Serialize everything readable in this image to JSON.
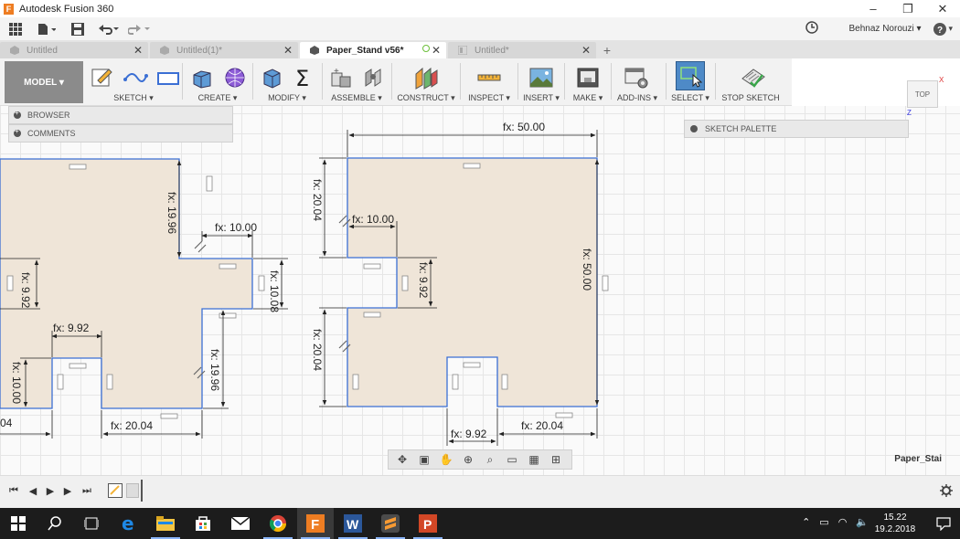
{
  "window": {
    "title": "Autodesk Fusion 360",
    "logo_letter": "F"
  },
  "quick_access": {
    "user": "Behnaz Norouzi ▾",
    "help": "?"
  },
  "tabs": [
    {
      "label": "Untitled",
      "active": false
    },
    {
      "label": "Untitled(1)*",
      "active": false
    },
    {
      "label": "Paper_Stand v56*",
      "active": true
    },
    {
      "label": "Untitled*",
      "active": false
    }
  ],
  "toolbar": {
    "workspace": "MODEL ▾",
    "groups": [
      {
        "label": "SKETCH ▾"
      },
      {
        "label": "CREATE ▾"
      },
      {
        "label": "MODIFY ▾"
      },
      {
        "label": "ASSEMBLE ▾"
      },
      {
        "label": "CONSTRUCT ▾"
      },
      {
        "label": "INSPECT ▾"
      },
      {
        "label": "INSERT ▾"
      },
      {
        "label": "MAKE ▾"
      },
      {
        "label": "ADD-INS ▾"
      },
      {
        "label": "SELECT ▾"
      },
      {
        "label": "STOP SKETCH"
      }
    ]
  },
  "panels": {
    "browser": "BROWSER",
    "comments": "COMMENTS",
    "sketch_palette": "SKETCH PALETTE"
  },
  "viewcube": {
    "label": "TOP",
    "axis_x": "X",
    "axis_z": "Z"
  },
  "dimensions": {
    "d1": "fx: 50.00",
    "d2": "fx: 20.04",
    "d3": "fx: 10.00",
    "d4": "fx: 9.92",
    "d5": "fx: 50.00",
    "d6": "fx: 20.04",
    "d7": "fx: 9.92",
    "d8": "fx: 20.04",
    "l1": "fx: 19.96",
    "l2": "fx: 10.00",
    "l3": "fx: 9.92",
    "l4": "fx: 10.08",
    "l5": "fx: 9.92",
    "l6": "fx: 10.00",
    "l7": "fx: 19.96",
    "l8": "fx: 20.04",
    "l9": "04"
  },
  "document_label": "Paper_Stai",
  "taskbar": {
    "time": "15.22",
    "date": "19.2.2018"
  },
  "colors": {
    "sketch_fill": "#efe5d8",
    "sketch_line": "#3b6fd4",
    "accent": "#4e8ac7"
  }
}
